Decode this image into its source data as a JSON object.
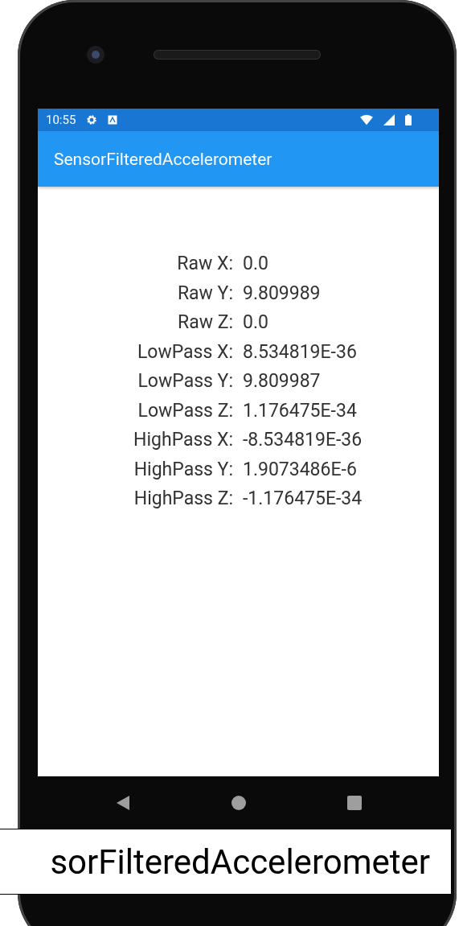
{
  "status_bar": {
    "time": "10:55"
  },
  "app_bar": {
    "title": "SensorFilteredAccelerometer"
  },
  "readings": [
    {
      "label": "Raw X:",
      "value": "0.0"
    },
    {
      "label": "Raw Y:",
      "value": "9.809989"
    },
    {
      "label": "Raw Z:",
      "value": "0.0"
    },
    {
      "label": "LowPass X:",
      "value": "8.534819E-36"
    },
    {
      "label": "LowPass Y:",
      "value": "9.809987"
    },
    {
      "label": "LowPass Z:",
      "value": "1.176475E-34"
    },
    {
      "label": "HighPass X:",
      "value": "-8.534819E-36"
    },
    {
      "label": "HighPass Y:",
      "value": "1.9073486E-6"
    },
    {
      "label": "HighPass Z:",
      "value": "-1.176475E-34"
    }
  ],
  "caption": "sorFilteredAccelerometer"
}
